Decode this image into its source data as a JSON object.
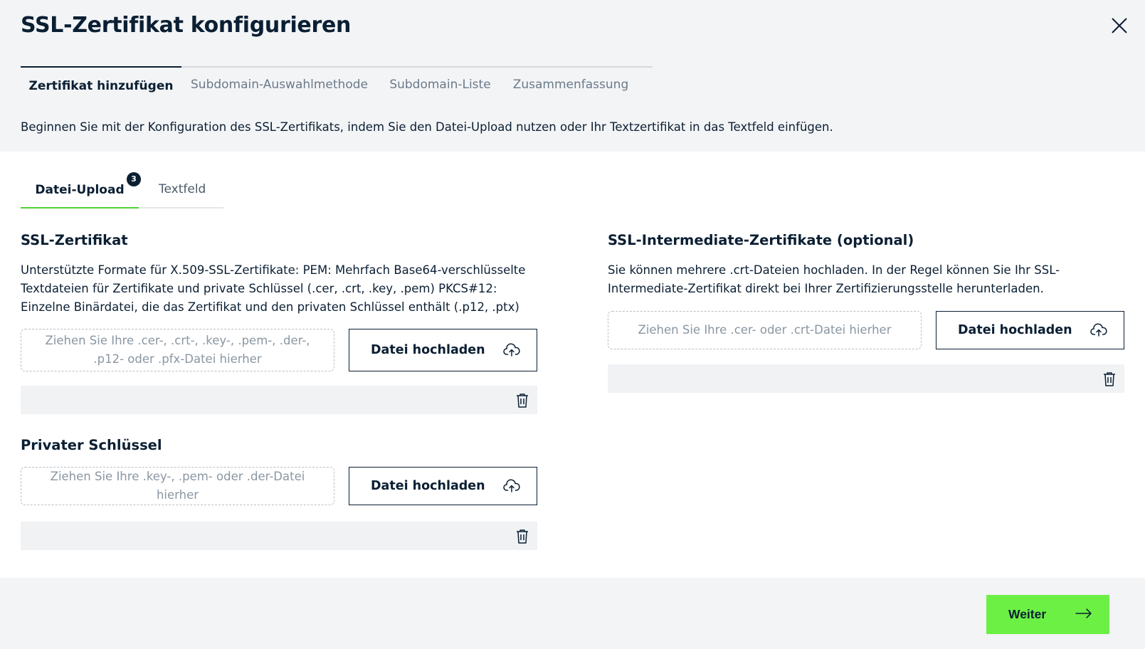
{
  "dialog": {
    "title": "SSL-Zertifikat konfigurieren",
    "close_icon": "close-icon"
  },
  "steps": [
    {
      "label": "Zertifikat hinzufügen",
      "active": true
    },
    {
      "label": "Subdomain-Auswahlmethode",
      "active": false
    },
    {
      "label": "Subdomain-Liste",
      "active": false
    },
    {
      "label": "Zusammenfassung",
      "active": false
    }
  ],
  "intro": "Beginnen Sie mit der Konfiguration des SSL-Zertifikats, indem Sie den Datei-Upload nutzen oder Ihr Textzertifikat in das Textfeld einfügen.",
  "subtabs": {
    "upload_label": "Datei-Upload",
    "upload_badge": "3",
    "text_label": "Textfeld"
  },
  "ssl_cert": {
    "title": "SSL-Zertifikat",
    "description": "Unterstützte Formate für X.509-SSL-Zertifikate: PEM: Mehrfach Base64-verschlüsselte Textdateien für Zertifikate und private Schlüssel (.cer, .crt, .key, .pem) PKCS#12: Einzelne Binärdatei, die das Zertifikat und den privaten Schlüssel enthält (.p12, .ptx)",
    "dropzone": "Ziehen Sie Ihre .cer-, .crt-, .key-, .pem-, .der-, .p12- oder .pfx-Datei hierher",
    "upload_label": "Datei hochladen"
  },
  "private_key": {
    "title": "Privater Schlüssel",
    "dropzone": "Ziehen Sie Ihre .key-, .pem- oder .der-Datei hierher",
    "upload_label": "Datei hochladen"
  },
  "intermediate": {
    "title": "SSL-Intermediate-Zertifikate (optional)",
    "description": "Sie können mehrere .crt-Dateien hochladen. In der Regel können Sie Ihr SSL-Intermediate-Zertifikat direkt bei Ihrer Zertifizierungsstelle herunterladen.",
    "dropzone": "Ziehen Sie Ihre .cer- oder .crt-Datei hierher",
    "upload_label": "Datei hochladen"
  },
  "footer": {
    "next_label": "Weiter"
  },
  "colors": {
    "primary_dark": "#0b1f33",
    "accent_green": "#6cf044",
    "tab_underline_green": "#4ed134",
    "page_bg": "#f3f4f6"
  },
  "icons": {
    "upload": "cloud-upload-icon",
    "delete": "trash-icon",
    "next": "arrow-right-icon"
  }
}
